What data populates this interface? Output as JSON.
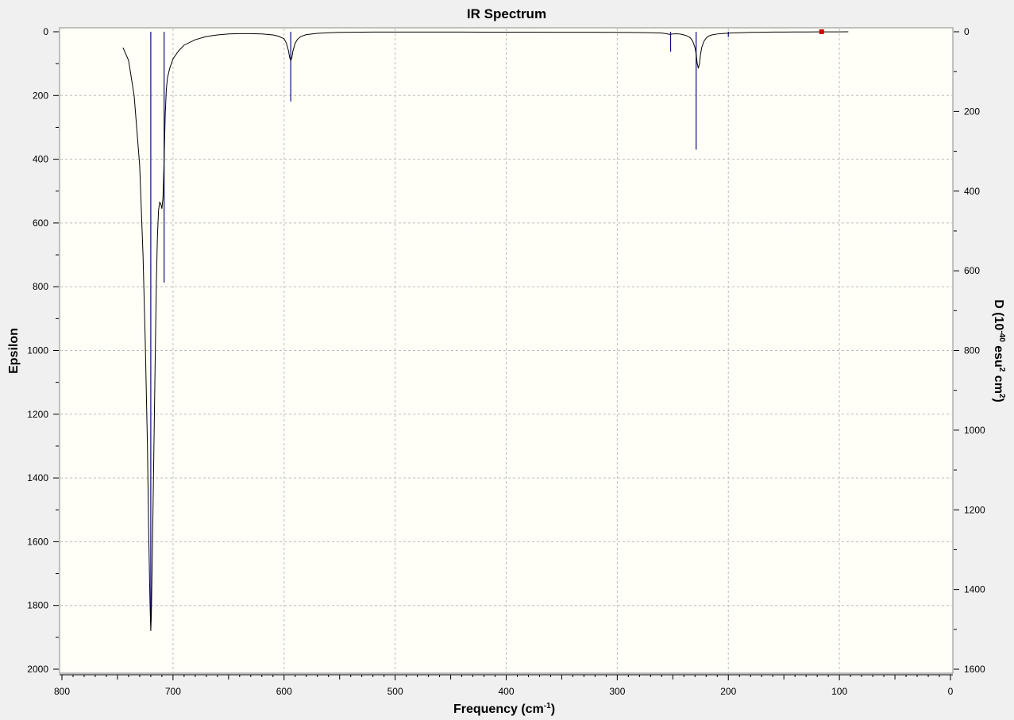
{
  "chart_data": {
    "type": "line",
    "title": "IR Spectrum",
    "xlabel": {
      "base": "Frequency (cm",
      "sup": "-1",
      "tail": ")"
    },
    "ylabel_left": "Epsilon",
    "ylabel_right": {
      "a": "D (10",
      "sup1": "-40",
      "b": " esu",
      "sup2": "2",
      "c": " cm",
      "sup3": "2",
      "d": ")"
    },
    "xlim": [
      800,
      0
    ],
    "ylim_left": [
      0,
      2000
    ],
    "ylim_right": [
      0,
      1600
    ],
    "x_ticks": [
      800,
      700,
      600,
      500,
      400,
      300,
      200,
      100,
      0
    ],
    "y_ticks_left": [
      0,
      200,
      400,
      600,
      800,
      1000,
      1200,
      1400,
      1600,
      1800,
      2000
    ],
    "y_ticks_right": [
      0,
      200,
      400,
      600,
      800,
      1000,
      1200,
      1400,
      1600
    ],
    "grid": true,
    "inverted_y": true,
    "series": [
      {
        "style": "spectrum-curve",
        "x": [
          745,
          740,
          735,
          730,
          727,
          725,
          723,
          722,
          721,
          720.5,
          720,
          719.5,
          719,
          718,
          717,
          716,
          715,
          714,
          713,
          712,
          711,
          710,
          709,
          708,
          707,
          706,
          705,
          703,
          700,
          695,
          690,
          680,
          670,
          660,
          650,
          640,
          630,
          620,
          610,
          605,
          600,
          598,
          596,
          595,
          594,
          593,
          592,
          590,
          588,
          585,
          580,
          570,
          560,
          550,
          540,
          530,
          520,
          500,
          480,
          460,
          440,
          420,
          400,
          380,
          360,
          340,
          320,
          300,
          290,
          280,
          270,
          260,
          258,
          256,
          254,
          253,
          252,
          251,
          250,
          248,
          246,
          244,
          242,
          240,
          238,
          236,
          234,
          232,
          230,
          229,
          228,
          227,
          226,
          225,
          224,
          222,
          220,
          218,
          215,
          210,
          205,
          203,
          202,
          200,
          198,
          195,
          190,
          185,
          180,
          170,
          160,
          150,
          140,
          130,
          120,
          110,
          100,
          92
        ],
        "y": [
          50,
          90,
          200,
          420,
          700,
          970,
          1300,
          1550,
          1740,
          1820,
          1880,
          1830,
          1720,
          1500,
          1260,
          1020,
          790,
          640,
          560,
          535,
          540,
          555,
          520,
          400,
          260,
          180,
          145,
          115,
          85,
          60,
          42,
          25,
          15,
          10,
          7,
          6,
          6,
          7,
          10,
          14,
          22,
          35,
          60,
          80,
          90,
          82,
          60,
          36,
          24,
          15,
          9,
          5,
          3,
          2,
          1.5,
          1.2,
          1,
          1,
          1,
          1,
          1,
          1.2,
          1.3,
          1.4,
          1.5,
          1.6,
          1.7,
          2,
          2.2,
          2.6,
          3,
          4,
          5,
          6,
          7.5,
          8,
          8,
          7.5,
          7,
          6.5,
          6.5,
          7,
          8,
          10,
          12,
          15,
          20,
          30,
          50,
          70,
          100,
          115,
          100,
          70,
          50,
          30,
          20,
          14,
          10,
          7,
          5.5,
          5,
          5,
          4.5,
          4,
          3.5,
          3,
          2.5,
          2,
          1.5,
          1,
          0.8,
          0.6,
          0.5,
          0.4,
          0.3,
          0.2,
          0.1
        ]
      },
      {
        "style": "sticks",
        "axis": "right",
        "x": [
          720,
          708,
          594,
          320,
          252,
          229,
          200
        ],
        "y": [
          1480,
          630,
          175,
          2,
          50,
          296,
          13
        ]
      }
    ],
    "marker": {
      "x": 116,
      "y": 0,
      "color": "#d00000"
    }
  },
  "colors": {
    "plot_bg": "#fffff7",
    "grid": "#bdbdbd",
    "curve": "#000000",
    "sticks": "#0b0b80",
    "window_bg": "#f0f0f0"
  }
}
